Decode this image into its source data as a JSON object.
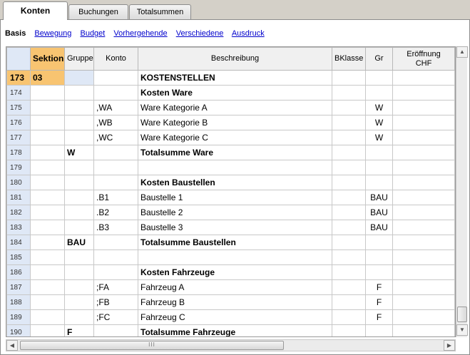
{
  "tabs": [
    "Konten",
    "Buchungen",
    "Totalsummen"
  ],
  "subnav": {
    "current": "Basis",
    "links": [
      "Bewegung",
      "Budget",
      "Vorhergehende",
      "Verschiedene",
      "Ausdruck"
    ]
  },
  "table": {
    "headers": {
      "sektion": "Sektion",
      "gruppe": "Gruppe",
      "konto": "Konto",
      "beschreibung": "Beschreibung",
      "bklasse": "BKlasse",
      "gr": "Gr",
      "eroeffnung_line1": "Eröffnung",
      "eroeffnung_line2": "CHF"
    },
    "rows": [
      {
        "num": "173",
        "sektion": "03",
        "gruppe": "",
        "konto": "",
        "beschreibung": "KOSTENSTELLEN",
        "bklasse": "",
        "gr": ""
      },
      {
        "num": "174",
        "sektion": "",
        "gruppe": "",
        "konto": "",
        "beschreibung": "Kosten Ware",
        "bklasse": "",
        "gr": ""
      },
      {
        "num": "175",
        "sektion": "",
        "gruppe": "",
        "konto": ",WA",
        "beschreibung": "Ware Kategorie A",
        "bklasse": "",
        "gr": "W"
      },
      {
        "num": "176",
        "sektion": "",
        "gruppe": "",
        "konto": ",WB",
        "beschreibung": "Ware Kategorie B",
        "bklasse": "",
        "gr": "W"
      },
      {
        "num": "177",
        "sektion": "",
        "gruppe": "",
        "konto": ",WC",
        "beschreibung": "Ware Kategorie C",
        "bklasse": "",
        "gr": "W"
      },
      {
        "num": "178",
        "sektion": "",
        "gruppe": "W",
        "konto": "",
        "beschreibung": "Totalsumme Ware",
        "bklasse": "",
        "gr": ""
      },
      {
        "num": "179",
        "sektion": "",
        "gruppe": "",
        "konto": "",
        "beschreibung": "",
        "bklasse": "",
        "gr": ""
      },
      {
        "num": "180",
        "sektion": "",
        "gruppe": "",
        "konto": "",
        "beschreibung": "Kosten Baustellen",
        "bklasse": "",
        "gr": ""
      },
      {
        "num": "181",
        "sektion": "",
        "gruppe": "",
        "konto": ".B1",
        "beschreibung": "Baustelle 1",
        "bklasse": "",
        "gr": "BAU"
      },
      {
        "num": "182",
        "sektion": "",
        "gruppe": "",
        "konto": ".B2",
        "beschreibung": "Baustelle 2",
        "bklasse": "",
        "gr": "BAU"
      },
      {
        "num": "183",
        "sektion": "",
        "gruppe": "",
        "konto": ".B3",
        "beschreibung": "Baustelle 3",
        "bklasse": "",
        "gr": "BAU"
      },
      {
        "num": "184",
        "sektion": "",
        "gruppe": "BAU",
        "konto": "",
        "beschreibung": "Totalsumme Baustellen",
        "bklasse": "",
        "gr": ""
      },
      {
        "num": "185",
        "sektion": "",
        "gruppe": "",
        "konto": "",
        "beschreibung": "",
        "bklasse": "",
        "gr": ""
      },
      {
        "num": "186",
        "sektion": "",
        "gruppe": "",
        "konto": "",
        "beschreibung": "Kosten Fahrzeuge",
        "bklasse": "",
        "gr": ""
      },
      {
        "num": "187",
        "sektion": "",
        "gruppe": "",
        "konto": ";FA",
        "beschreibung": "Fahrzeug A",
        "bklasse": "",
        "gr": "F"
      },
      {
        "num": "188",
        "sektion": "",
        "gruppe": "",
        "konto": ";FB",
        "beschreibung": "Fahrzeug B",
        "bklasse": "",
        "gr": "F"
      },
      {
        "num": "189",
        "sektion": "",
        "gruppe": "",
        "konto": ";FC",
        "beschreibung": "Fahrzeug C",
        "bklasse": "",
        "gr": "F"
      },
      {
        "num": "190",
        "sektion": "",
        "gruppe": "F",
        "konto": "",
        "beschreibung": "Totalsumme Fahrzeuge",
        "bklasse": "",
        "gr": ""
      }
    ],
    "bold_rows": [
      0,
      1,
      5,
      7,
      11,
      13,
      17
    ],
    "selected_row": 0
  },
  "scrollbar_grip": "III",
  "colors": {
    "selection": "#f8c471",
    "rownum_bg": "#dfe8f6",
    "link": "#0000cc"
  }
}
